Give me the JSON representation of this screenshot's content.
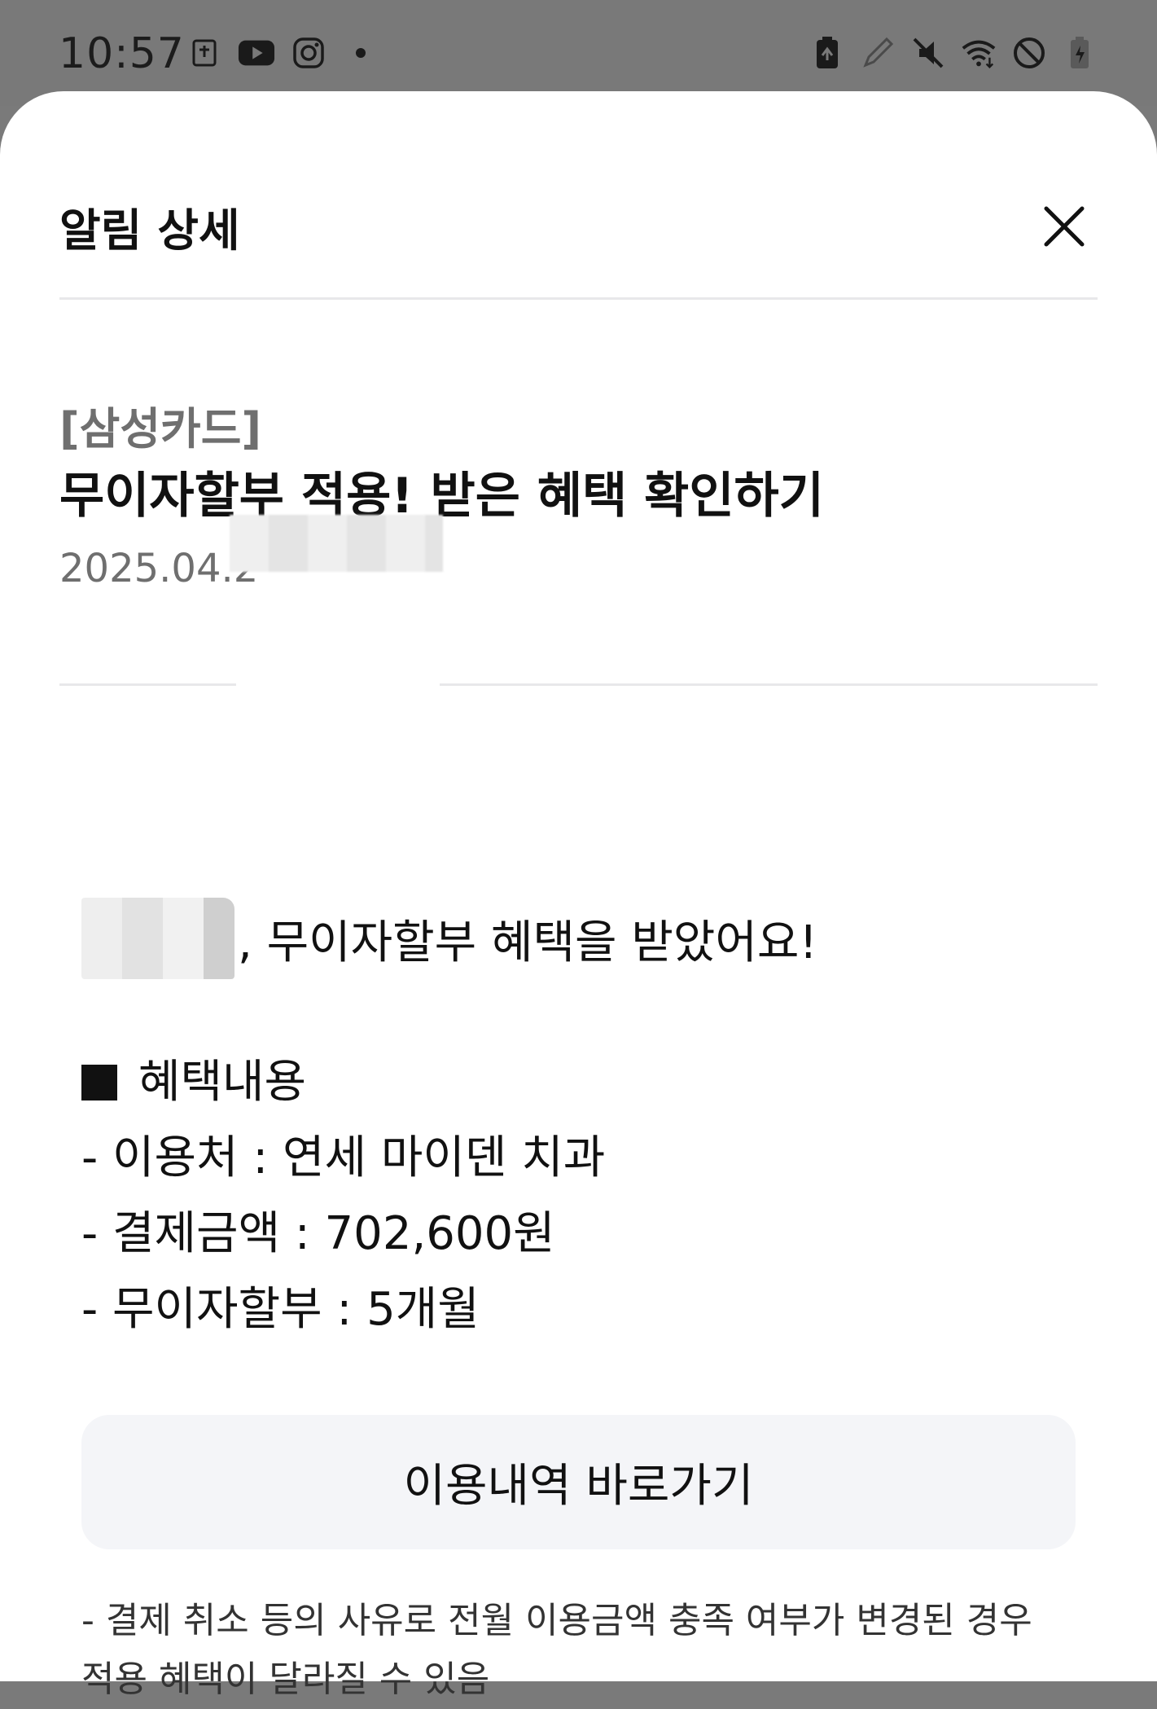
{
  "status_bar": {
    "time": "10:57",
    "left_icons": [
      "bible-app-icon",
      "youtube-icon",
      "instagram-icon",
      "notification-dot-icon"
    ],
    "right_icons": [
      "battery-saver-icon",
      "pen-icon",
      "mute-icon",
      "wifi-icon",
      "do-not-disturb-icon",
      "battery-charging-icon"
    ]
  },
  "sheet": {
    "title": "알림 상세",
    "close_icon": "close-icon"
  },
  "notification": {
    "sender": "[삼성카드]",
    "headline": "무이자할부 적용! 받은 혜택 확인하기",
    "date": "2025.04.2",
    "greeting_suffix": ", 무이자할부 혜택을 받았어요!",
    "benefit_heading": "혜택내용",
    "lines": [
      "- 이용처 : 연세 마이덴 치과",
      "- 결제금액 : 702,600원",
      "- 무이자할부 : 5개월"
    ],
    "button_label": "이용내역 바로가기",
    "notice_line1": "- 결제 취소 등의 사유로 전월 이용금액 충족 여부가 변경된 경우",
    "notice_line2": "적용 혜택이 달라질 수 있음"
  },
  "colors": {
    "status_bar_bg": "#797979",
    "sheet_bg": "#ffffff",
    "muted_text": "#6f6f6f",
    "button_bg": "#f4f5f8",
    "divider": "#e8e8ea"
  }
}
